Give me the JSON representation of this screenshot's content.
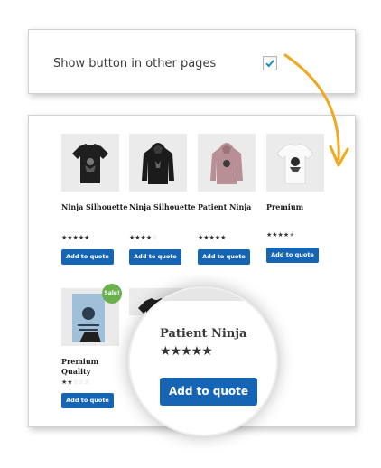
{
  "settings": {
    "show_button_label": "Show button in other pages",
    "show_button_checked": true
  },
  "products": [
    {
      "name": "Ninja Silhouette",
      "rating": 5,
      "button": "Add to quote",
      "shirt": "black-tshirt"
    },
    {
      "name": "Ninja Silhouette",
      "rating": 4,
      "button": "Add to quote",
      "shirt": "black-hoodie"
    },
    {
      "name": "Patient Ninja",
      "rating": 5,
      "button": "Add to quote",
      "shirt": "pink-hoodie"
    },
    {
      "name": "Premium",
      "rating": 4.5,
      "button": "Add to quote",
      "shirt": "white-tshirt"
    },
    {
      "name": "Premium Quality",
      "rating": 2,
      "button": "Add to quote",
      "shirt": "poster",
      "badge": "Sale!"
    }
  ],
  "magnifier": {
    "name": "Patient Ninja",
    "rating": 5,
    "button": "Add to quote"
  },
  "colors": {
    "button": "#1565b4",
    "arrow": "#f0a81e",
    "sale_badge": "#6ab04c"
  }
}
